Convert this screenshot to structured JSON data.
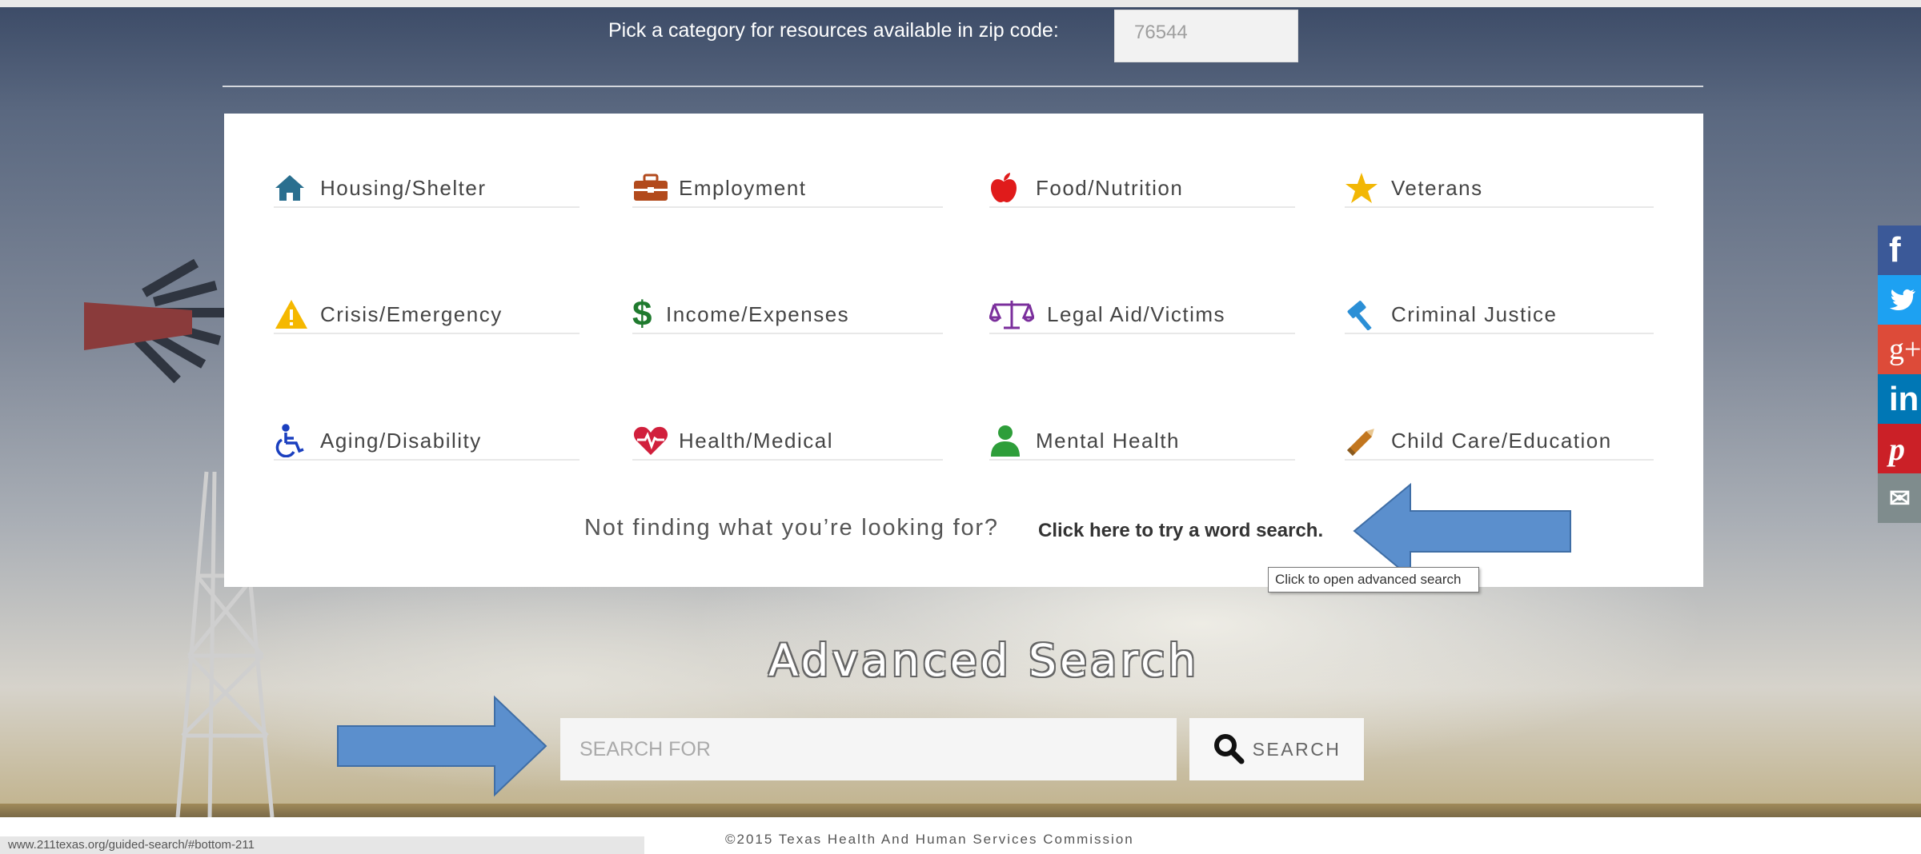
{
  "zip": {
    "label": "Pick a category for resources available in zip code:",
    "value": "76544"
  },
  "categories": [
    {
      "label": "Housing/Shelter",
      "icon": "home-icon",
      "color": "#2a6f8f"
    },
    {
      "label": "Employment",
      "icon": "briefcase-icon",
      "color": "#b24a1c"
    },
    {
      "label": "Food/Nutrition",
      "icon": "apple-icon",
      "color": "#e01b1b"
    },
    {
      "label": "Veterans",
      "icon": "star-icon",
      "color": "#f2b705"
    },
    {
      "label": "Crisis/Emergency",
      "icon": "warning-icon",
      "color": "#f5b800"
    },
    {
      "label": "Income/Expenses",
      "icon": "dollar-icon",
      "color": "#1f7a2e"
    },
    {
      "label": "Legal Aid/Victims",
      "icon": "scales-icon",
      "color": "#7b2f9c"
    },
    {
      "label": "Criminal Justice",
      "icon": "gavel-icon",
      "color": "#2b8fd6"
    },
    {
      "label": "Aging/Disability",
      "icon": "wheelchair-icon",
      "color": "#1a3fbf"
    },
    {
      "label": "Health/Medical",
      "icon": "heartbeat-icon",
      "color": "#d11f3c"
    },
    {
      "label": "Mental Health",
      "icon": "person-icon",
      "color": "#2e9e3a"
    },
    {
      "label": "Child Care/Education",
      "icon": "pencil-icon",
      "color": "#c2761e"
    }
  ],
  "not_finding": {
    "text": "Not finding what you’re looking for?",
    "link": "Click here to try a word search."
  },
  "tooltip": "Click to open advanced search",
  "advanced_search": {
    "title": "Advanced Search",
    "placeholder": "SEARCH FOR",
    "button_label": "SEARCH"
  },
  "share": [
    {
      "icon": "facebook-icon",
      "glyph": "f",
      "color": "#3b5998"
    },
    {
      "icon": "twitter-icon",
      "glyph": "t",
      "color": "#1da1f2"
    },
    {
      "icon": "google-plus-icon",
      "glyph": "g+",
      "color": "#dd4b39"
    },
    {
      "icon": "linkedin-icon",
      "glyph": "in",
      "color": "#0077b5"
    },
    {
      "icon": "pinterest-icon",
      "glyph": "p",
      "color": "#cb2027"
    },
    {
      "icon": "email-icon",
      "glyph": "✉",
      "color": "#7f8c8d"
    }
  ],
  "status_url": "www.211texas.org/guided-search/#bottom-211",
  "footer": {
    "copyright": "©2015 Texas Health And Human Services Commission"
  }
}
